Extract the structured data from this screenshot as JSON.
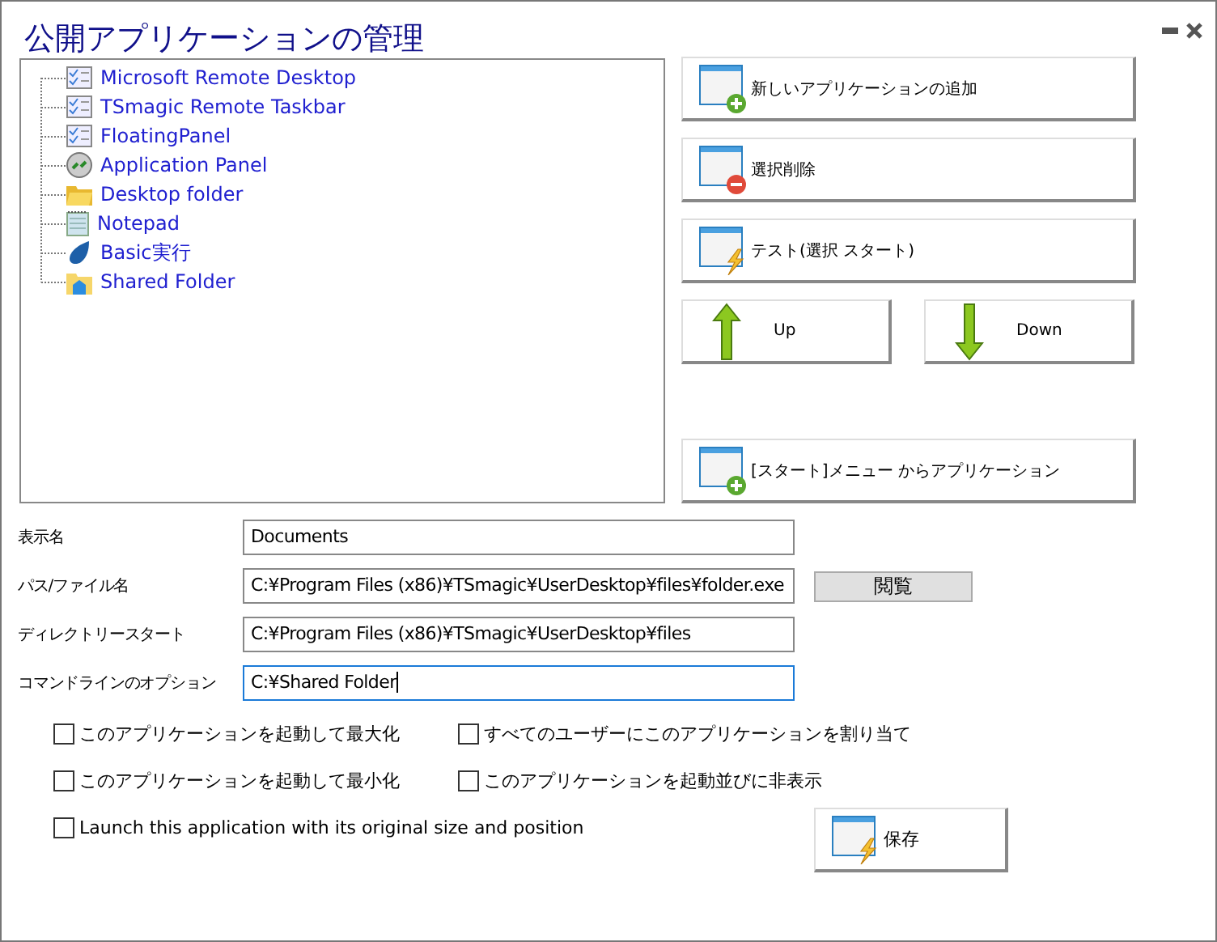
{
  "window": {
    "title": "公開アプリケーションの管理"
  },
  "tree": {
    "items": [
      {
        "label": "Microsoft Remote Desktop",
        "kind": "app"
      },
      {
        "label": "TSmagic Remote Taskbar",
        "kind": "app"
      },
      {
        "label": "FloatingPanel",
        "kind": "app"
      },
      {
        "label": "Application Panel",
        "kind": "remote"
      },
      {
        "label": "Desktop folder",
        "kind": "folder"
      },
      {
        "label": "Notepad",
        "kind": "notepad"
      },
      {
        "label": "Basic実行",
        "kind": "drop"
      },
      {
        "label": "Shared Folder",
        "kind": "shared"
      }
    ]
  },
  "actions": [
    {
      "label": "新しいアプリケーションの追加",
      "kind": "add"
    },
    {
      "label": "選択削除",
      "kind": "remove"
    },
    {
      "label": "テスト(選択 スタート)",
      "kind": "test"
    }
  ],
  "move_buttons": [
    {
      "label": "Up",
      "kind": "up"
    },
    {
      "label": "Down",
      "kind": "down"
    }
  ],
  "start_menu_button": {
    "label": "[スタート]メニュー からアプリケーション",
    "kind": "add"
  },
  "fields": [
    {
      "label": "表示名",
      "value": "Documents",
      "focused": false
    },
    {
      "label": "パス/ファイル名",
      "value": "C:¥Program Files (x86)¥TSmagic¥UserDesktop¥files¥folder.exe",
      "focused": false,
      "browse": "閲覧"
    },
    {
      "label": "ディレクトリースタート",
      "value": "C:¥Program Files (x86)¥TSmagic¥UserDesktop¥files",
      "focused": false
    },
    {
      "label": "コマンドラインのオプション",
      "value": "C:¥Shared Folder",
      "focused": true
    }
  ],
  "options": [
    {
      "label": "このアプリケーションを起動して最大化",
      "checked": false
    },
    {
      "label": "すべてのユーザーにこのアプリケーションを割り当て",
      "checked": false
    },
    {
      "label": "このアプリケーションを起動して最小化",
      "checked": false
    },
    {
      "label": "このアプリケーションを起動並びに非表示",
      "checked": false
    },
    {
      "label": "Launch this application with its original size and position",
      "checked": false
    }
  ],
  "save_button": {
    "label": "保存",
    "kind": "test"
  }
}
